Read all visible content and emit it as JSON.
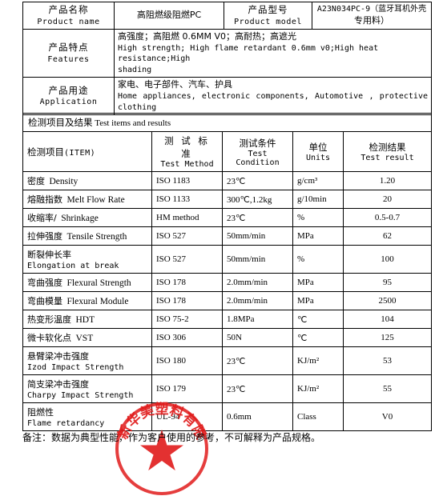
{
  "info": {
    "rows": [
      {
        "label_cn": "产品名称",
        "label_en": "Product name",
        "value_cn": "高阻燃级阻燃PC",
        "label2_cn": "产品型号",
        "label2_en": "Product model",
        "value2_line1": "A23N034PC-9（蓝牙耳机外壳",
        "value2_line2": "专用料）"
      },
      {
        "label_cn": "产品特点",
        "label_en": "Features",
        "value_cn": "高强度；高阻燃 0.6MM V0；高耐热；高遮光",
        "value_en_line1": "High strength; High flame retardant 0.6mm v0;High heat resistance;High",
        "value_en_line2": "shading"
      },
      {
        "label_cn": "产品用途",
        "label_en": "Application",
        "value_cn": "家电、电子部件、汽车、护具",
        "value_en_line1": "Home appliances, electronic components, Automotive , protective",
        "value_en_line2": "clothing"
      }
    ]
  },
  "results": {
    "section_title_cn": "检测项目及结果",
    "section_title_en": "Test items and results",
    "headers": {
      "item_cn": "检测项目",
      "item_en": "(ITEM)",
      "method_cn": "测 试 标 准",
      "method_en": "Test Method",
      "condition_cn": "测试条件",
      "condition_en": "Test Condition",
      "units_cn": "单位",
      "units_en": "Units",
      "result_cn": "检测结果",
      "result_en": "Test result"
    },
    "rows": [
      {
        "item_cn": "密度",
        "item_en": "Density",
        "two_line": false,
        "method": "ISO 1183",
        "condition": "23℃",
        "units": "g/cm³",
        "result": "1.20"
      },
      {
        "item_cn": "熔融指数",
        "item_en": "Melt Flow Rate",
        "two_line": false,
        "method": "ISO 1133",
        "condition": "300℃,1.2kg",
        "units": "g/10min",
        "result": "20"
      },
      {
        "item_cn": "收缩率/",
        "item_en": "Shrinkage",
        "two_line": false,
        "method": "HM method",
        "condition": "23℃",
        "units": "%",
        "result": "0.5-0.7"
      },
      {
        "item_cn": "拉伸强度",
        "item_en": "Tensile Strength",
        "two_line": false,
        "method": "ISO 527",
        "condition": "50mm/min",
        "units": "MPa",
        "result": "62"
      },
      {
        "item_cn": "断裂伸长率",
        "item_en": "Elongation at break",
        "two_line": true,
        "method": "ISO 527",
        "condition": "50mm/min",
        "units": "%",
        "result": "100"
      },
      {
        "item_cn": "弯曲强度",
        "item_en": "Flexural Strength",
        "two_line": false,
        "method": "ISO 178",
        "condition": "2.0mm/min",
        "units": "MPa",
        "result": "95"
      },
      {
        "item_cn": "弯曲模量",
        "item_en": "Flexural Module",
        "two_line": false,
        "method": "ISO 178",
        "condition": "2.0mm/min",
        "units": "MPa",
        "result": "2500"
      },
      {
        "item_cn": "热变形温度",
        "item_en": "HDT",
        "two_line": false,
        "method": "ISO 75-2",
        "condition": "1.8MPa",
        "units": "℃",
        "result": "104"
      },
      {
        "item_cn": "微卡软化点",
        "item_en": "VST",
        "two_line": false,
        "method": "ISO 306",
        "condition": "50N",
        "units": "℃",
        "result": "125"
      },
      {
        "item_cn": "悬臂梁冲击强度",
        "item_en": "Izod Impact Strength",
        "two_line": true,
        "method": "ISO 180",
        "condition": "23℃",
        "units": "KJ/m²",
        "result": "53"
      },
      {
        "item_cn": "简支梁冲击强度",
        "item_en": "Charpy Impact Strength",
        "two_line": true,
        "method": "ISO 179",
        "condition": "23℃",
        "units": "KJ/m²",
        "result": "55"
      },
      {
        "item_cn": "阻燃性",
        "item_en": "Flame retardancy",
        "two_line": true,
        "method": "UL-94",
        "condition": "0.6mm",
        "units": "Class",
        "result": "V0"
      }
    ]
  },
  "note": "备注：数据为典型性能，作为客户使用的参考，不可解释为产品规格。",
  "seal": {
    "text_top": "新华美塑料有限",
    "color": "#e01b1b"
  }
}
